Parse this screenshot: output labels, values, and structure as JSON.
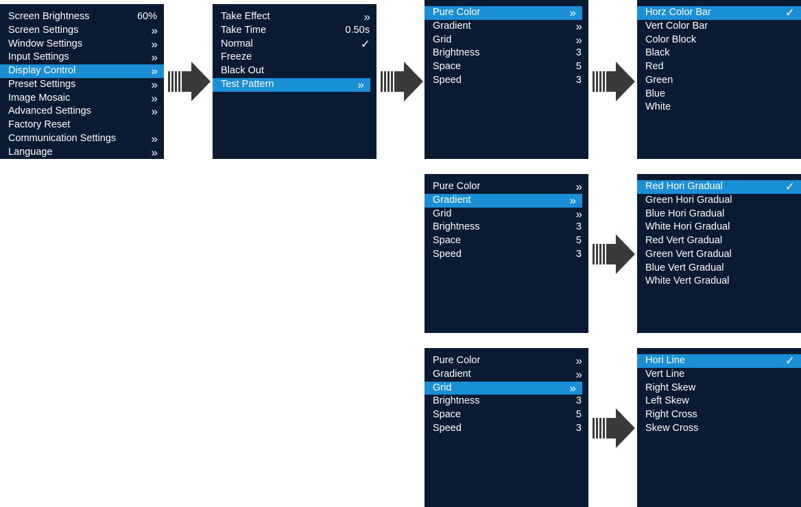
{
  "main_menu": {
    "items": [
      {
        "label": "Screen Brightness",
        "value": "60%"
      },
      {
        "label": "Screen Settings",
        "chevron": "»"
      },
      {
        "label": "Window Settings",
        "chevron": "»"
      },
      {
        "label": "Input Settings",
        "chevron": "»"
      },
      {
        "label": "Display Control",
        "chevron": "»",
        "selected": true
      },
      {
        "label": "Preset Settings",
        "chevron": "»"
      },
      {
        "label": "Image Mosaic",
        "chevron": "»"
      },
      {
        "label": "Advanced Settings",
        "chevron": "»"
      },
      {
        "label": "Factory Reset"
      },
      {
        "label": "Communication Settings",
        "chevron": "»"
      },
      {
        "label": "Language",
        "chevron": "»"
      }
    ]
  },
  "display_control_menu": {
    "items": [
      {
        "label": "Take Effect",
        "chevron": "»"
      },
      {
        "label": "Take Time",
        "value": "0.50s"
      },
      {
        "label": "Normal",
        "check": "✓"
      },
      {
        "label": "Freeze"
      },
      {
        "label": "Black Out"
      },
      {
        "label": "Test Pattern",
        "chevron": "»",
        "selected": true
      }
    ]
  },
  "test_pattern_menus": [
    {
      "items": [
        {
          "label": "Pure Color",
          "chevron": "»",
          "selected": true
        },
        {
          "label": "Gradient",
          "chevron": "»"
        },
        {
          "label": "Grid",
          "chevron": "»"
        },
        {
          "label": "Brightness",
          "value": "3"
        },
        {
          "label": "Space",
          "value": "5"
        },
        {
          "label": "Speed",
          "value": "3"
        }
      ]
    },
    {
      "items": [
        {
          "label": "Pure Color",
          "chevron": "»"
        },
        {
          "label": "Gradient",
          "chevron": "»",
          "selected": true
        },
        {
          "label": "Grid",
          "chevron": "»"
        },
        {
          "label": "Brightness",
          "value": "3"
        },
        {
          "label": "Space",
          "value": "5"
        },
        {
          "label": "Speed",
          "value": "3"
        }
      ]
    },
    {
      "items": [
        {
          "label": "Pure Color",
          "chevron": "»"
        },
        {
          "label": "Gradient",
          "chevron": "»"
        },
        {
          "label": "Grid",
          "chevron": "»",
          "selected": true
        },
        {
          "label": "Brightness",
          "value": "3"
        },
        {
          "label": "Space",
          "value": "5"
        },
        {
          "label": "Speed",
          "value": "3"
        }
      ]
    }
  ],
  "pure_color_options": {
    "items": [
      {
        "label": "Horz Color Bar",
        "check": "✓",
        "selected": true
      },
      {
        "label": "Vert Color Bar"
      },
      {
        "label": "Color Block"
      },
      {
        "label": "Black"
      },
      {
        "label": "Red"
      },
      {
        "label": "Green"
      },
      {
        "label": "Blue"
      },
      {
        "label": "White"
      }
    ]
  },
  "gradient_options": {
    "items": [
      {
        "label": "Red Hori Gradual",
        "check": "✓",
        "selected": true
      },
      {
        "label": "Green Hori Gradual"
      },
      {
        "label": "Blue Hori Gradual"
      },
      {
        "label": "White Hori Gradual"
      },
      {
        "label": "Red Vert Gradual"
      },
      {
        "label": "Green Vert Gradual"
      },
      {
        "label": "Blue Vert Gradual"
      },
      {
        "label": "White Vert Gradual"
      }
    ]
  },
  "grid_options": {
    "items": [
      {
        "label": "Hori Line",
        "check": "✓",
        "selected": true
      },
      {
        "label": "Vert Line"
      },
      {
        "label": "Right Skew"
      },
      {
        "label": "Left Skew"
      },
      {
        "label": "Right Cross"
      },
      {
        "label": "Skew Cross"
      }
    ]
  },
  "colors": {
    "panel_bg": "#0b1a33",
    "selected_bg": "#1a8fd6",
    "text": "#ffffff",
    "arrow": "#3a3a3a"
  },
  "icons": {
    "arrow": "right-arrow-icon",
    "chevron": "double-chevron-right-icon",
    "check": "checkmark-icon"
  }
}
